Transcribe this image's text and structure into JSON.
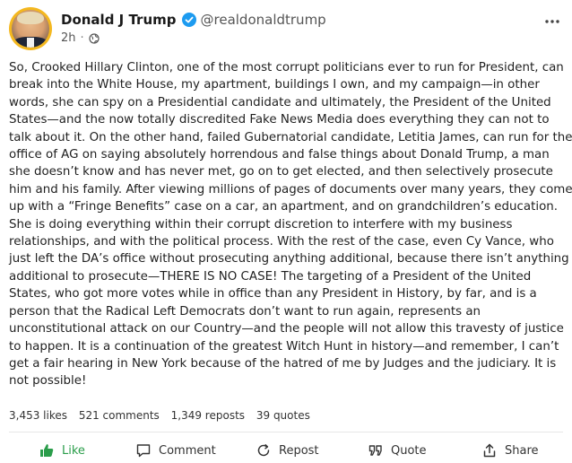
{
  "author": {
    "display_name": "Donald J Trump",
    "handle": "@realdonaldtrump",
    "time": "2h",
    "separator": "·"
  },
  "post": {
    "lines": [
      "So, Crooked Hillary Clinton, one of the most corrupt politicians ever to run for President, can",
      "break into the White House, my apartment, buildings I own, and my campaign—in other",
      "words, she can spy on a Presidential candidate and ultimately, the President of the United",
      "States—and the now totally discredited Fake News Media does everything they can not to",
      "talk about it. On the other hand, failed Gubernatorial candidate, Letitia James, can run for the",
      "office of AG on saying absolutely horrendous and false things about Donald Trump, a man",
      "she doesn’t know and has never met, go on to get elected, and then selectively prosecute",
      "him and his family. After viewing millions of pages of documents over many years, they come",
      "up with a “Fringe Benefits” case on a car, an apartment, and on grandchildren’s education.",
      "She is doing everything within their corrupt discretion to interfere with my business",
      "relationships, and with the political process. With the rest of the case, even Cy Vance, who",
      "just left the DA’s office without prosecuting anything additional, because there isn’t anything",
      "additional to prosecute—THERE IS NO CASE! The targeting of a President of the United",
      "States, who got more votes while in office than any President in History, by far, and is a",
      "person that the Radical Left Democrats don’t want to run again, represents an",
      "unconstitutional attack on our Country—and the people will not allow this travesty of justice",
      "to happen. It is a continuation of the greatest Witch Hunt in history—and remember, I can’t",
      "get a fair hearing in New York because of the hatred of me by Judges and the judiciary. It is",
      "not possible!"
    ]
  },
  "stats": {
    "likes": "3,453 likes",
    "comments": "521 comments",
    "reposts": "1,349 reposts",
    "quotes": "39 quotes"
  },
  "actions": {
    "like": "Like",
    "comment": "Comment",
    "repost": "Repost",
    "quote": "Quote",
    "share": "Share"
  },
  "colors": {
    "like_green": "#2a9d4a",
    "verified_blue": "#1d9bf0",
    "avatar_ring": "#f4b81f"
  },
  "icons": {
    "verified": "verified-check-icon",
    "visibility": "globe-icon",
    "more": "more-horizontal-icon",
    "like": "thumbs-up-icon",
    "comment": "speech-bubble-icon",
    "repost": "repost-arrow-icon",
    "quote": "quote-marks-icon",
    "share": "share-upload-icon"
  }
}
